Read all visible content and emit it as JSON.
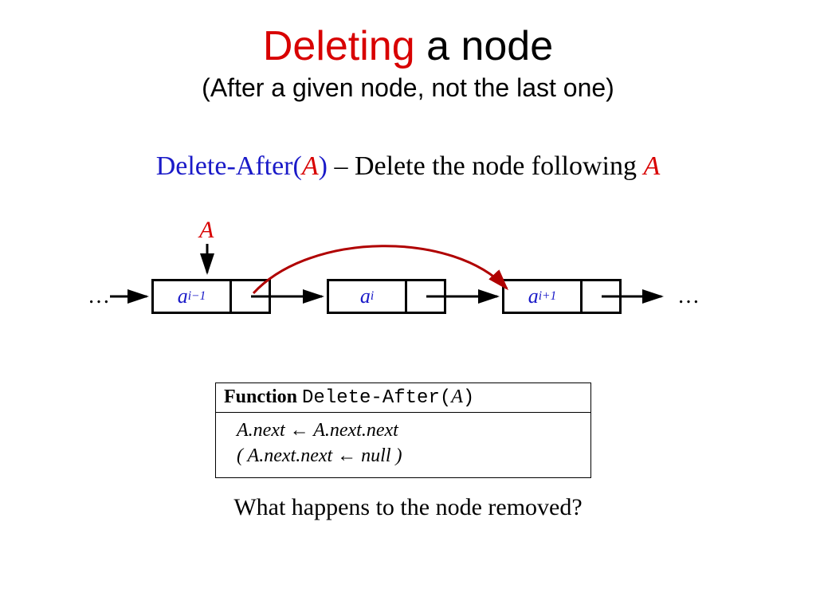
{
  "title": {
    "red": "Deleting",
    "rest": " a node"
  },
  "subtitle": "(After a given node, not the last one)",
  "desc": {
    "func": "Delete-After(",
    "arg": "A",
    "close": ")",
    "dash": " – ",
    "text": "Delete the node following ",
    "tail": "A"
  },
  "diagram": {
    "aLabel": "A",
    "dotsLeft": "…",
    "dotsRight": "…",
    "nodes": [
      {
        "base": "a",
        "sub": "i−1"
      },
      {
        "base": "a",
        "sub": "i"
      },
      {
        "base": "a",
        "sub": "i+1"
      }
    ]
  },
  "func": {
    "keyword": "Function",
    "name": "Delete-After(",
    "arg": "A",
    "close": ")",
    "line1": "A.next ← A.next.next",
    "line2": "( A.next.next ← null )"
  },
  "question": "What happens to the node removed?"
}
